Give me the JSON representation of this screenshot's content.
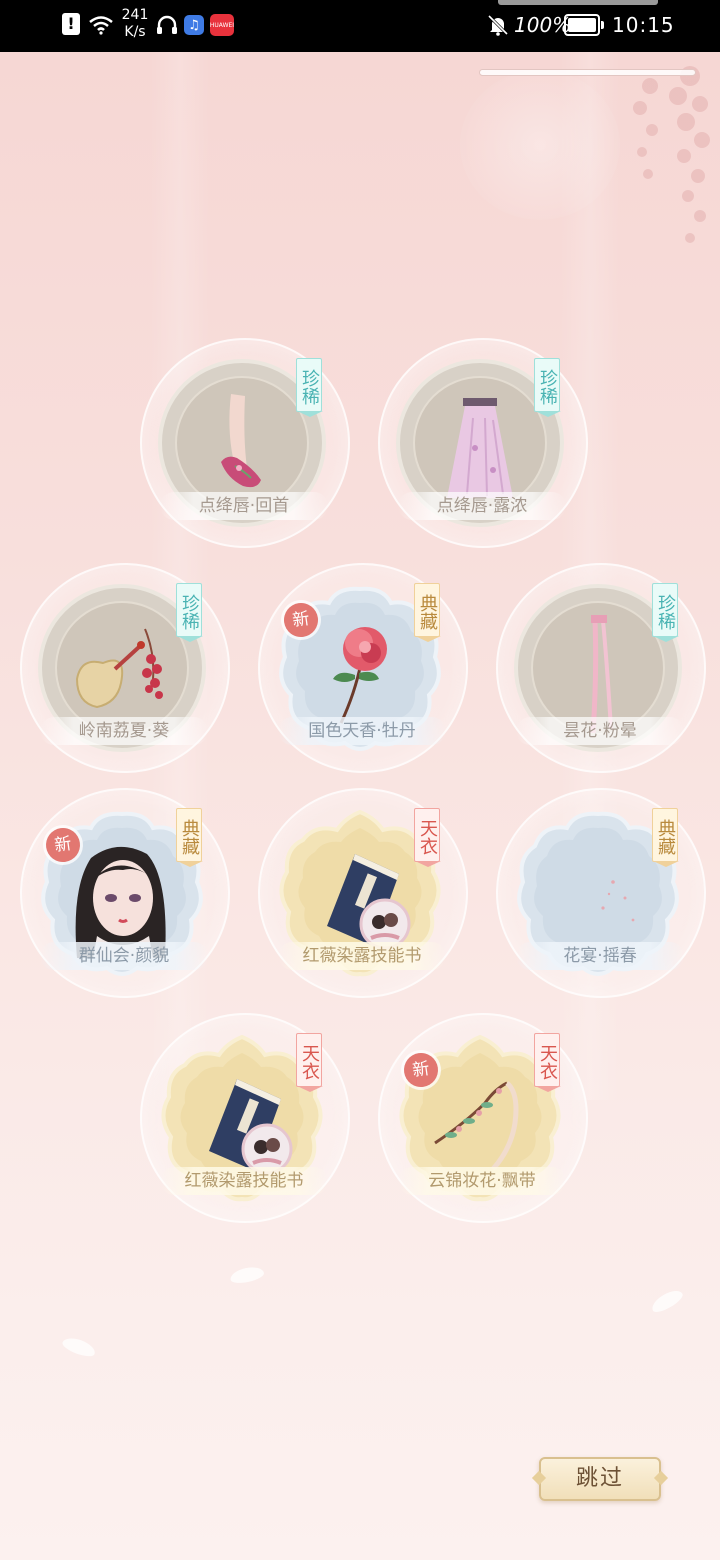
{
  "status_bar": {
    "net_speed_value": "241",
    "net_speed_unit": "K/s",
    "music_icon_label": "♫",
    "huawei_label": "HUAWEI",
    "battery": "100%",
    "time": "10:15"
  },
  "items": [
    {
      "name": "点绛唇·回首",
      "tag": "珍稀",
      "is_new": false
    },
    {
      "name": "点绛唇·露浓",
      "tag": "珍稀",
      "is_new": false
    },
    {
      "name": "岭南荔夏·葵",
      "tag": "珍稀",
      "is_new": false
    },
    {
      "name": "国色天香·牡丹",
      "tag": "典藏",
      "is_new": true
    },
    {
      "name": "昙花·粉晕",
      "tag": "珍稀",
      "is_new": false
    },
    {
      "name": "群仙会·颜貌",
      "tag": "典藏",
      "is_new": true
    },
    {
      "name": "红薇染露技能书",
      "tag": "天衣",
      "is_new": false
    },
    {
      "name": "花宴·摇春",
      "tag": "典藏",
      "is_new": false
    },
    {
      "name": "红薇染露技能书",
      "tag": "天衣",
      "is_new": false
    },
    {
      "name": "云锦妆花·飘带",
      "tag": "天衣",
      "is_new": true
    }
  ],
  "new_label": "新",
  "skip_button": "跳过",
  "colors": {
    "tag_rare": "#4ab3b3",
    "tag_collection": "#b98a3d",
    "tag_heavenly": "#d9574f",
    "new_badge": "#e27771"
  }
}
